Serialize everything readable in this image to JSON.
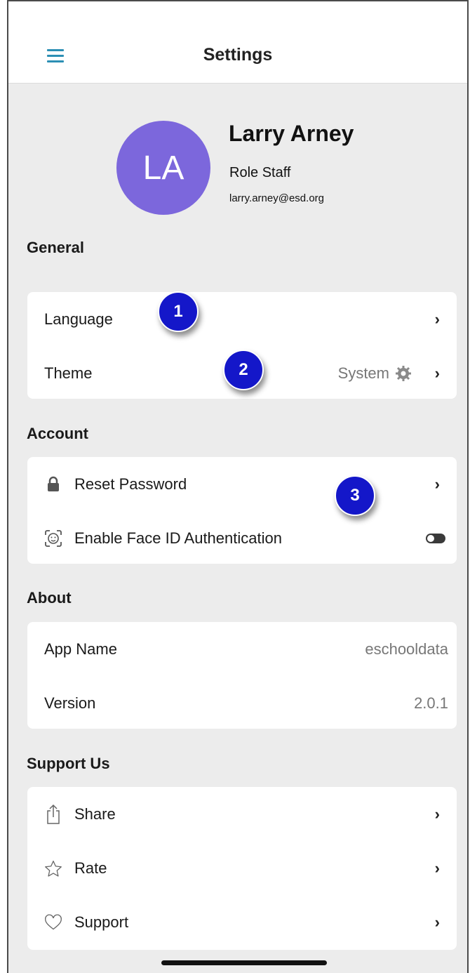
{
  "header": {
    "title": "Settings"
  },
  "profile": {
    "initials": "LA",
    "name": "Larry Arney",
    "role": "Role Staff",
    "email": "larry.arney@esd.org",
    "avatar_color": "#7c67dc"
  },
  "sections": {
    "general": {
      "label": "General",
      "language_label": "Language",
      "theme_label": "Theme",
      "theme_value": "System"
    },
    "account": {
      "label": "Account",
      "reset_password_label": "Reset Password",
      "face_id_label": "Enable Face ID Authentication"
    },
    "about": {
      "label": "About",
      "app_name_label": "App Name",
      "app_name_value": "eschooldata",
      "version_label": "Version",
      "version_value": "2.0.1"
    },
    "support": {
      "label": "Support Us",
      "share_label": "Share",
      "rate_label": "Rate",
      "support_label": "Support"
    }
  },
  "callouts": [
    "1",
    "2",
    "3"
  ],
  "icons": {
    "menu": "hamburger-icon",
    "chevron": "chevron-right-icon",
    "theme": "gear-icon",
    "reset": "lock-icon",
    "face_id": "face-id-icon",
    "share": "share-icon",
    "rate": "star-icon",
    "support": "heart-icon"
  },
  "colors": {
    "accent": "#2c8fb4",
    "badge": "#1417c9",
    "background": "#ececec"
  }
}
